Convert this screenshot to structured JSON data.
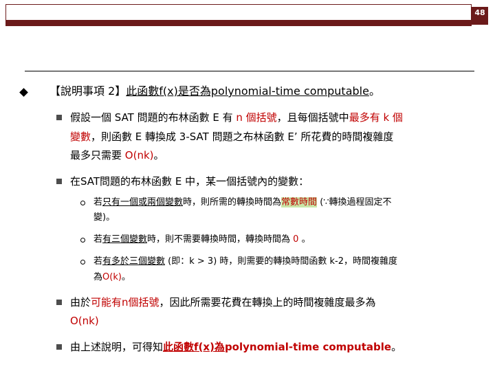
{
  "header": {
    "page_number": "48",
    "bar_color": "#6b1a1a"
  },
  "colors": {
    "accent_red": "#c00000",
    "highlight_green": "#c9e6a8"
  },
  "bullets": {
    "b1": {
      "prefix": "【說明事項 2】",
      "link": "此函數f(x)是否為polynomial-time computable",
      "end": "。"
    },
    "b1_1": {
      "line1_a": "假設一個 SAT 問題的布林函數 E 有 ",
      "line1_b": "n 個括號",
      "line1_c": "，且每個括號中",
      "line1_d": "最多有 k 個",
      "line2_a": "變數",
      "line2_b": "，則函數 E 轉換成 3-SAT 問題之布林函數 E’ 所花費的時間複雜度",
      "line3_a": "最多只需要 ",
      "line3_b": "O(nk)",
      "line3_c": "。"
    },
    "b1_2": {
      "text": "在SAT問題的布林函數 E 中，某一個括號內的變數："
    },
    "b1_2_1": {
      "a": "若",
      "b": "只有一個或兩個變數",
      "c": "時，則所需的轉換時間為",
      "d": "常數時間",
      "e": " (∵轉換過程固定不",
      "line2": "變)。"
    },
    "b1_2_2": {
      "a": "若",
      "b": "有三個變數",
      "c": "時，則不需要轉換時間，轉換時間為 ",
      "d": "0",
      "e": " 。"
    },
    "b1_2_3": {
      "a": "若",
      "b": "有多於三個變數",
      "c": " (即：k > 3) 時，則需要的轉換時間函數 k-2，時間複雜度",
      "line2_a": "為",
      "line2_b": "O(k)",
      "line2_c": "。"
    },
    "b1_3": {
      "line1_a": "由於",
      "line1_b": "可能有",
      "line1_c": "n個括號",
      "line1_d": "，因此所需要花費在轉換上的時間複雜度最多為",
      "line2": "O(nk)"
    },
    "b1_4": {
      "a": "由上述說明，可得知",
      "b": "此函數f(x)為",
      "c": "polynomial-time computable",
      "d": "。"
    }
  }
}
